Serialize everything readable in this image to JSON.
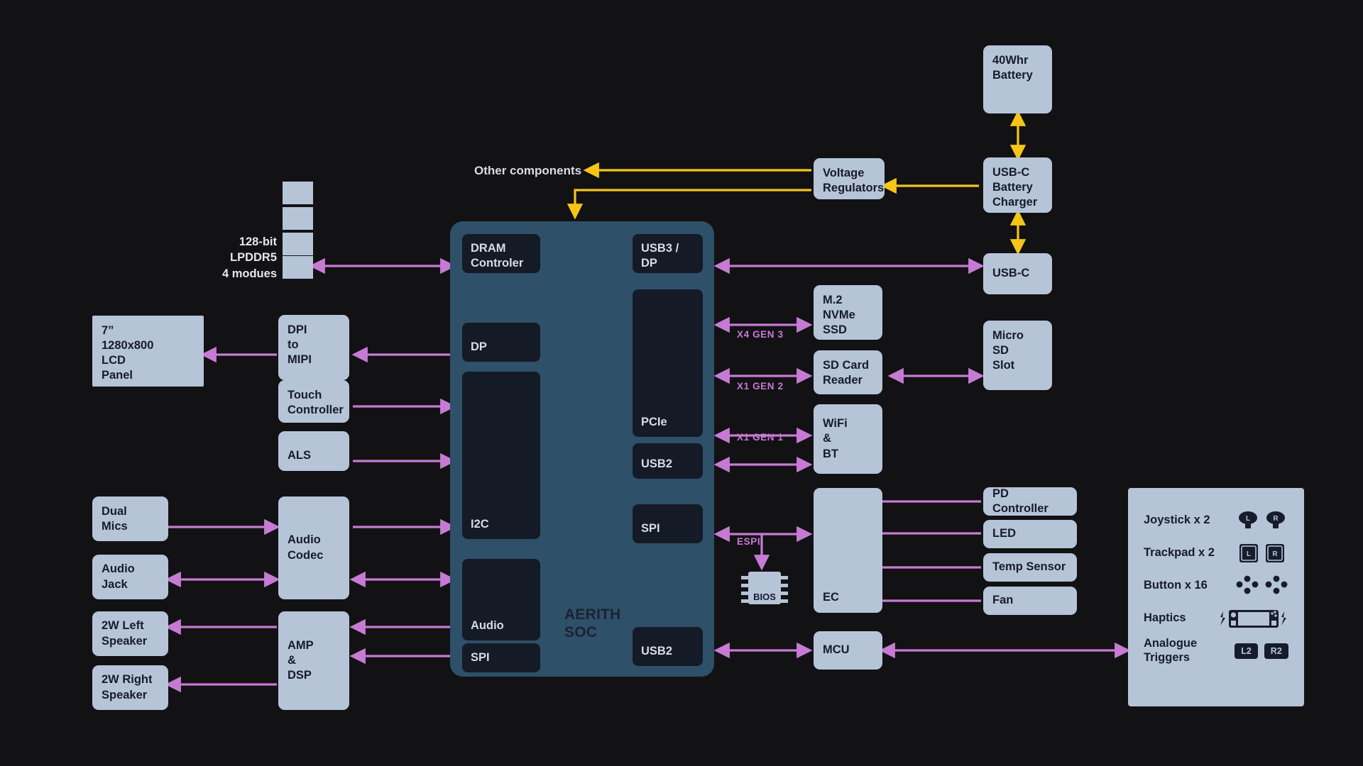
{
  "colors": {
    "background": "#121114",
    "block_fill": "#b6c4d8",
    "block_text": "#161c2b",
    "soc_fill": "#2e5068",
    "ip_fill": "#141a26",
    "ip_text": "#d6dde6",
    "data_wire": "#c77ad4",
    "power_wire": "#f5c518"
  },
  "soc": {
    "name": "AERITH\nSOC",
    "left_blocks": [
      {
        "id": "dram-controller",
        "label": "DRAM\nControler"
      },
      {
        "id": "dp",
        "label": "DP"
      },
      {
        "id": "i2c",
        "label": "I2C"
      },
      {
        "id": "audio",
        "label": "Audio"
      },
      {
        "id": "spi-left",
        "label": "SPI"
      }
    ],
    "right_blocks": [
      {
        "id": "usb3-dp",
        "label": "USB3 /\nDP"
      },
      {
        "id": "pcie",
        "label": "PCIe"
      },
      {
        "id": "usb2-upper",
        "label": "USB2"
      },
      {
        "id": "spi-right",
        "label": "SPI"
      },
      {
        "id": "usb2-lower",
        "label": "USB2"
      }
    ]
  },
  "memory": {
    "label": "128-bit\nLPDDR5\n4 modues",
    "module_count": 4
  },
  "left_blocks": [
    {
      "id": "lcd-panel",
      "label": "7”\n1280x800\nLCD\nPanel"
    },
    {
      "id": "dpi-to-mipi",
      "label": "DPI\nto\nMIPI"
    },
    {
      "id": "touch-controller",
      "label": "Touch\nController"
    },
    {
      "id": "als",
      "label": "ALS"
    },
    {
      "id": "dual-mics",
      "label": "Dual\nMics"
    },
    {
      "id": "audio-jack",
      "label": "Audio\nJack"
    },
    {
      "id": "audio-codec",
      "label": "Audio\nCodec"
    },
    {
      "id": "speaker-left",
      "label": "2W Left\nSpeaker"
    },
    {
      "id": "speaker-right",
      "label": "2W Right\nSpeaker"
    },
    {
      "id": "amp-dsp",
      "label": "AMP\n&\nDSP"
    }
  ],
  "right_blocks": [
    {
      "id": "battery",
      "label": "40Whr\nBattery"
    },
    {
      "id": "usbc-battery-charger",
      "label": "USB-C\nBattery\nCharger"
    },
    {
      "id": "voltage-regulators",
      "label": "Voltage\nRegulators"
    },
    {
      "id": "usbc",
      "label": "USB-C"
    },
    {
      "id": "m2-nvme-ssd",
      "label": "M.2\nNVMe\nSSD"
    },
    {
      "id": "sd-card-reader",
      "label": "SD Card\nReader"
    },
    {
      "id": "micro-sd-slot",
      "label": "Micro\nSD\nSlot"
    },
    {
      "id": "wifi-bt",
      "label": "WiFi\n&\nBT"
    },
    {
      "id": "ec",
      "label": "EC"
    },
    {
      "id": "mcu",
      "label": "MCU"
    },
    {
      "id": "pd-controller",
      "label": "PD Controller"
    },
    {
      "id": "led",
      "label": "LED"
    },
    {
      "id": "temp-sensor",
      "label": "Temp Sensor"
    },
    {
      "id": "fan",
      "label": "Fan"
    }
  ],
  "bios": {
    "label": "BIOS"
  },
  "free_text": {
    "other_components": "Other components"
  },
  "connector_labels": {
    "x4_gen3": "X4 GEN 3",
    "x1_gen2": "X1 GEN 2",
    "x1_gen1": "X1 GEN 1",
    "espi": "ESPI"
  },
  "controls_panel": {
    "rows": [
      {
        "id": "joystick",
        "label": "Joystick x 2",
        "icon": "joystick-pair-icon",
        "badges": [
          "L",
          "R"
        ]
      },
      {
        "id": "trackpad",
        "label": "Trackpad x 2",
        "icon": "trackpad-pair-icon",
        "badges": [
          "L",
          "R"
        ]
      },
      {
        "id": "button",
        "label": "Button x 16",
        "icon": "button-cluster-icon",
        "badges": []
      },
      {
        "id": "haptics",
        "label": "Haptics",
        "icon": "haptics-device-icon",
        "badges": []
      },
      {
        "id": "analogue-triggers",
        "label": "Analogue\nTriggers",
        "icon": "trigger-pair-icon",
        "badges": [
          "L2",
          "R2"
        ]
      }
    ]
  }
}
